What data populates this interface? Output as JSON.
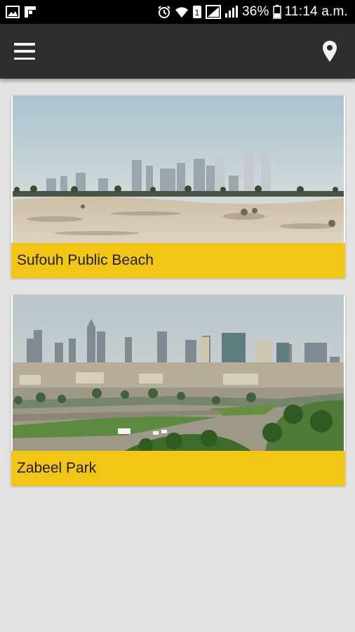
{
  "status_bar": {
    "battery": "36%",
    "time": "11:14 a.m.",
    "icons": [
      "image-icon",
      "flipboard-icon",
      "alarm-icon",
      "wifi-icon",
      "data-icon",
      "signal-icon",
      "signal-icon",
      "battery-icon"
    ]
  },
  "app_bar": {
    "menu_icon": "hamburger-menu-icon",
    "location_icon": "location-pin-icon"
  },
  "cards": [
    {
      "title": "Sufouh Public Beach",
      "image": "desert-skyline-photo"
    },
    {
      "title": "Zabeel Park",
      "image": "park-skyline-photo"
    }
  ],
  "colors": {
    "status_bar": "#000000",
    "app_bar": "#2d2d2d",
    "background": "#e3e3e3",
    "card_label": "#f2c615"
  }
}
